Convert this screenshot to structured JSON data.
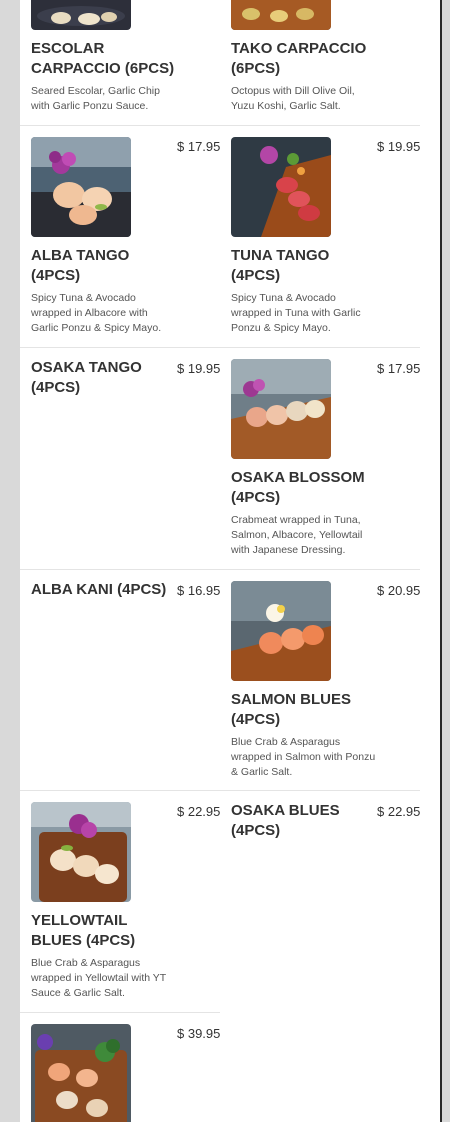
{
  "menu": {
    "items": [
      {
        "key": "escolar",
        "title": "ESCOLAR CARPACCIO (6PCS)",
        "description": "Seared Escolar, Garlic Chip with Garlic Ponzu Sauce.",
        "price": "",
        "image": "escolar-carpaccio-photo"
      },
      {
        "key": "tako",
        "title": "TAKO CARPACCIO (6PCS)",
        "description": "Octopus with Dill Olive Oil, Yuzu Koshi, Garlic Salt.",
        "price": "",
        "image": "tako-carpaccio-photo"
      },
      {
        "key": "alba_tango",
        "title": "ALBA TANGO (4PCS)",
        "description": "Spicy Tuna & Avocado wrapped in Albacore with Garlic Ponzu & Spicy Mayo.",
        "price": "$ 17.95",
        "image": "alba-tango-photo"
      },
      {
        "key": "tuna_tango",
        "title": "TUNA TANGO (4PCS)",
        "description": "Spicy Tuna & Avocado wrapped in Tuna with Garlic Ponzu & Spicy Mayo.",
        "price": "$ 19.95",
        "image": "tuna-tango-photo"
      },
      {
        "key": "osaka_tango",
        "title": "OSAKA TANGO (4PCS)",
        "description": "",
        "price": "$ 19.95",
        "image": ""
      },
      {
        "key": "osaka_blossom",
        "title": "OSAKA BLOSSOM (4PCS)",
        "description": "Crabmeat wrapped in Tuna, Salmon, Albacore, Yellowtail with Japanese Dressing.",
        "price": "$ 17.95",
        "image": "osaka-blossom-photo"
      },
      {
        "key": "alba_kani",
        "title": "ALBA KANI (4PCS)",
        "description": "",
        "price": "$ 16.95",
        "image": ""
      },
      {
        "key": "salmon_blues",
        "title": "SALMON BLUES (4PCS)",
        "description": "Blue Crab & Asparagus wrapped in Salmon with Ponzu & Garlic Salt.",
        "price": "$ 20.95",
        "image": "salmon-blues-photo"
      },
      {
        "key": "yellowtail_blues",
        "title": "YELLOWTAIL BLUES (4PCS)",
        "description": "Blue Crab & Asparagus wrapped in Yellowtail with YT Sauce & Garlic Salt.",
        "price": "$ 22.95",
        "image": "yellowtail-blues-photo"
      },
      {
        "key": "osaka_blues",
        "title": "OSAKA BLUES (4PCS)",
        "description": "",
        "price": "$ 22.95",
        "image": ""
      },
      {
        "key": "last_item",
        "title": "",
        "description": "",
        "price": "$ 39.95",
        "image": "platter-photo"
      }
    ]
  }
}
